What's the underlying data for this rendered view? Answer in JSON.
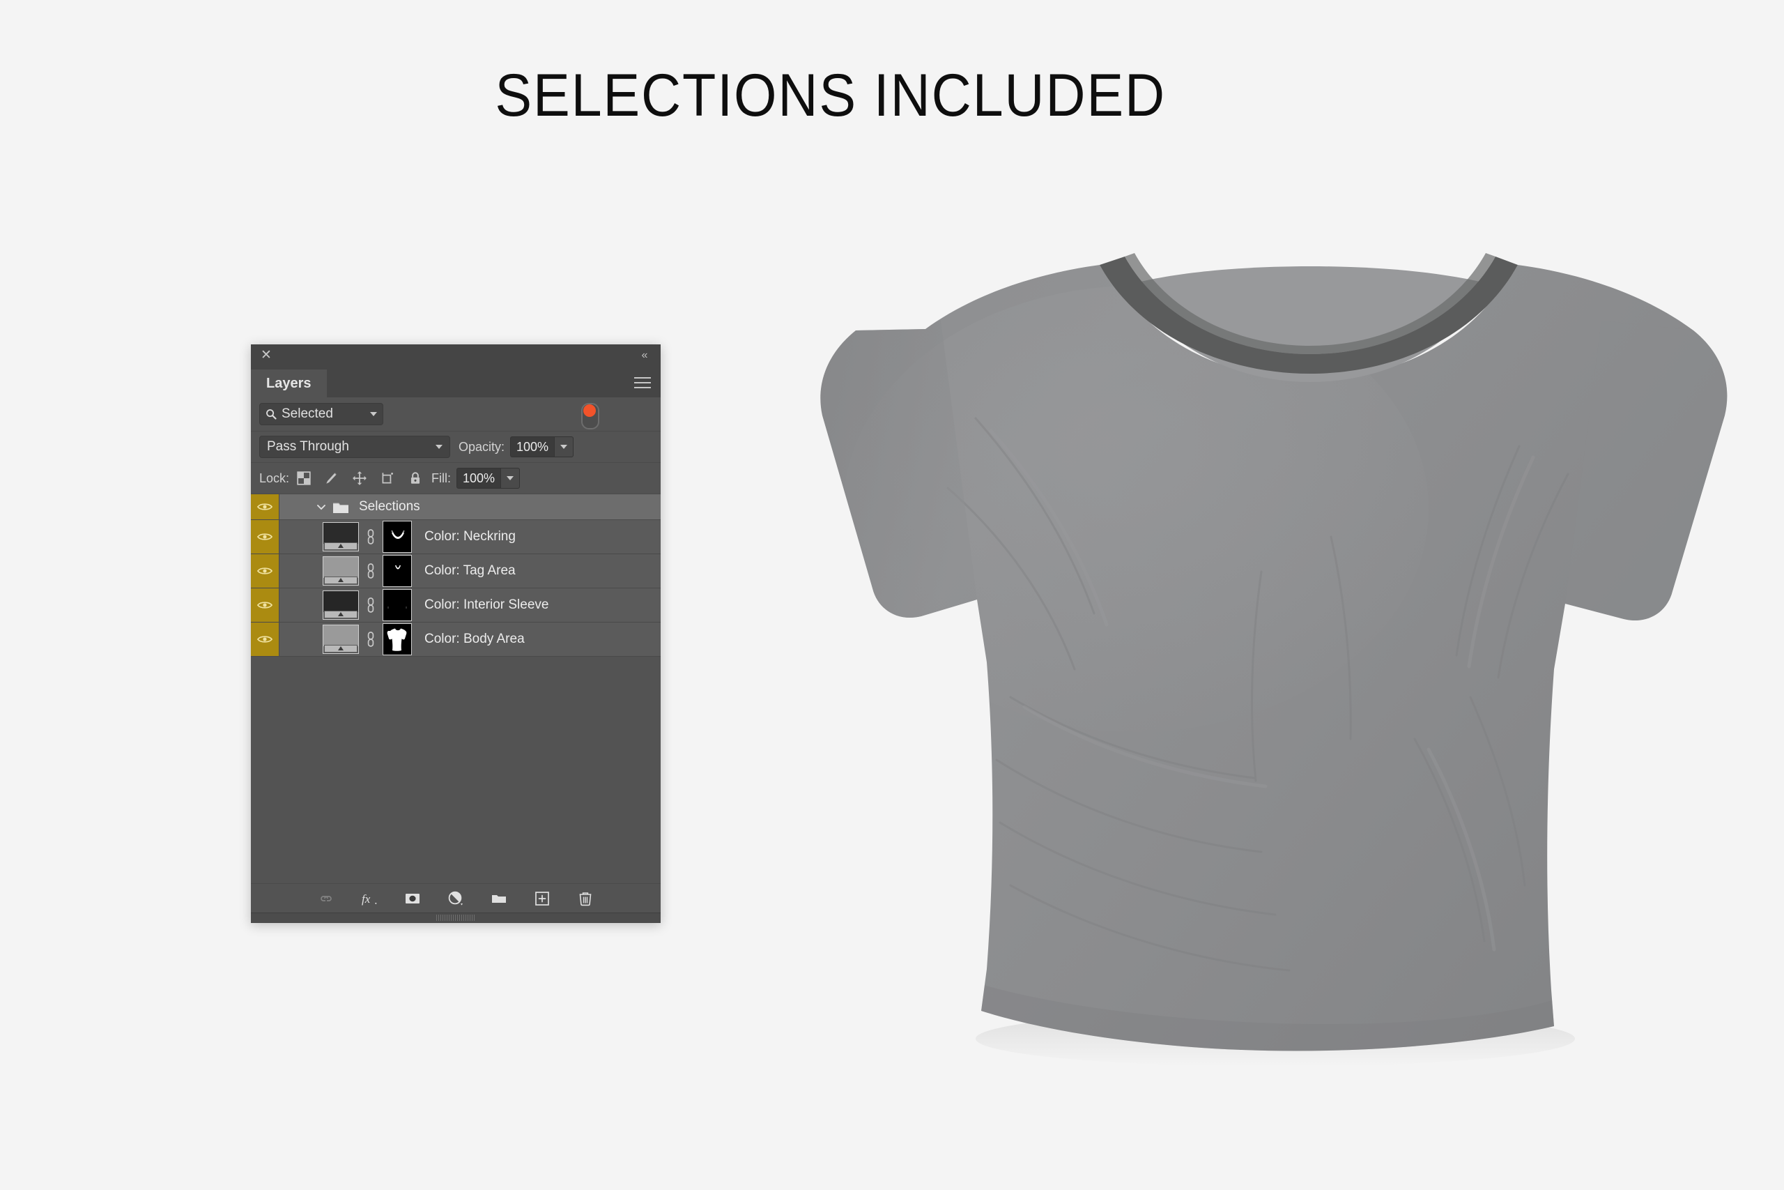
{
  "page": {
    "headline": "SELECTIONS INCLUDED",
    "background_color": "#f4f4f4"
  },
  "product": {
    "name": "t-shirt-mockup",
    "body_color": "#8d8e90",
    "neckband_color": "#5b5c5c",
    "shadow_color": "#d9d9d9"
  },
  "panel": {
    "title": "Layers",
    "close_icon": "close-icon",
    "collapse_icon": "collapse-icon",
    "menu_icon": "panel-menu-icon",
    "filter": {
      "icon": "search-icon",
      "value": "Selected",
      "toggle_on": true,
      "toggle_color": "#f2532a"
    },
    "blend": {
      "mode": "Pass Through",
      "opacity_label": "Opacity:",
      "opacity_value": "100%"
    },
    "lock": {
      "label": "Lock:",
      "icons": [
        "lock-transparent-pixels-icon",
        "lock-image-pixels-icon",
        "lock-position-icon",
        "lock-artboard-nesting-icon",
        "lock-all-icon"
      ],
      "fill_label": "Fill:",
      "fill_value": "100%"
    },
    "group": {
      "name": "Selections",
      "expanded": true,
      "visible": true,
      "selected": true,
      "folder_icon": "folder-icon",
      "caret_icon": "chevron-down-icon"
    },
    "layers": [
      {
        "name": "Color: Neckring",
        "visible": true,
        "fill_color": "#2b2b2b",
        "mask": "neckring-mask",
        "link_icon": "link-icon"
      },
      {
        "name": "Color: Tag Area",
        "visible": true,
        "fill_color": "#9a9a9a",
        "mask": "tag-area-mask",
        "link_icon": "link-icon"
      },
      {
        "name": "Color: Interior Sleeve",
        "visible": true,
        "fill_color": "#262626",
        "mask": "interior-sleeve-mask",
        "link_icon": "link-icon"
      },
      {
        "name": "Color: Body Area",
        "visible": true,
        "fill_color": "#9a9a9a",
        "mask": "body-area-mask",
        "link_icon": "link-icon"
      }
    ],
    "bottom_toolbar": [
      "link-layers-icon",
      "layer-effects-fx-icon",
      "add-layer-mask-icon",
      "new-adjustment-layer-icon",
      "new-group-icon",
      "new-layer-icon",
      "delete-layer-icon"
    ],
    "colors": {
      "panel_bg": "#535353",
      "header_bg": "#454545",
      "row_bg": "#5b5b5b",
      "selected_row_bg": "#6d6d6d",
      "eye_cell_bg": "#ab8b11",
      "eye_icon": "#f0e2a0",
      "text": "#ececec"
    }
  }
}
